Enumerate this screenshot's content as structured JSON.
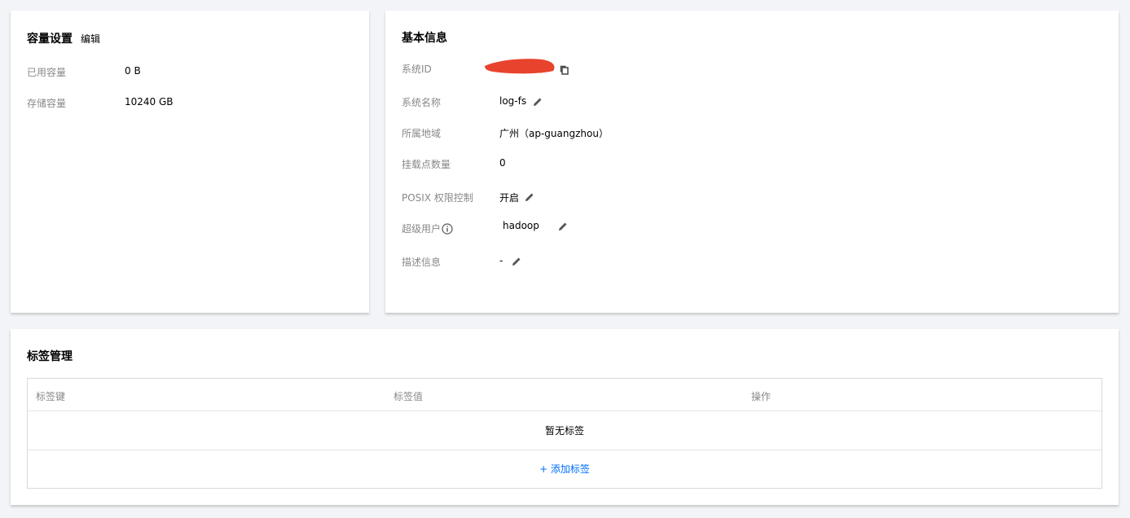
{
  "capacity": {
    "title": "容量设置",
    "edit_label": "编辑",
    "used_label": "已用容量",
    "used_value": "0 B",
    "storage_label": "存储容量",
    "storage_value": "10240 GB"
  },
  "info": {
    "title": "基本信息",
    "rows": {
      "system_id": {
        "label": "系统ID",
        "value": ""
      },
      "system_name": {
        "label": "系统名称",
        "value": "log-fs"
      },
      "region": {
        "label": "所属地域",
        "value": "广州（ap-guangzhou）"
      },
      "mount_count": {
        "label": "挂载点数量",
        "value": "0"
      },
      "posix": {
        "label": "POSIX 权限控制",
        "value": "开启"
      },
      "superuser": {
        "label": "超级用户",
        "value": "hadoop"
      },
      "description": {
        "label": "描述信息",
        "value": "-"
      }
    }
  },
  "tags": {
    "title": "标签管理",
    "columns": [
      "标签键",
      "标签值",
      "操作"
    ],
    "empty_text": "暂无标签",
    "add_label": "+ 添加标签"
  },
  "colors": {
    "accent": "#006eff",
    "redaction": "#e8432d",
    "label_gray": "#888888",
    "background": "#f3f4f7"
  },
  "icons": {
    "copy": "copy-icon",
    "edit": "pencil-icon",
    "info": "info-icon"
  }
}
